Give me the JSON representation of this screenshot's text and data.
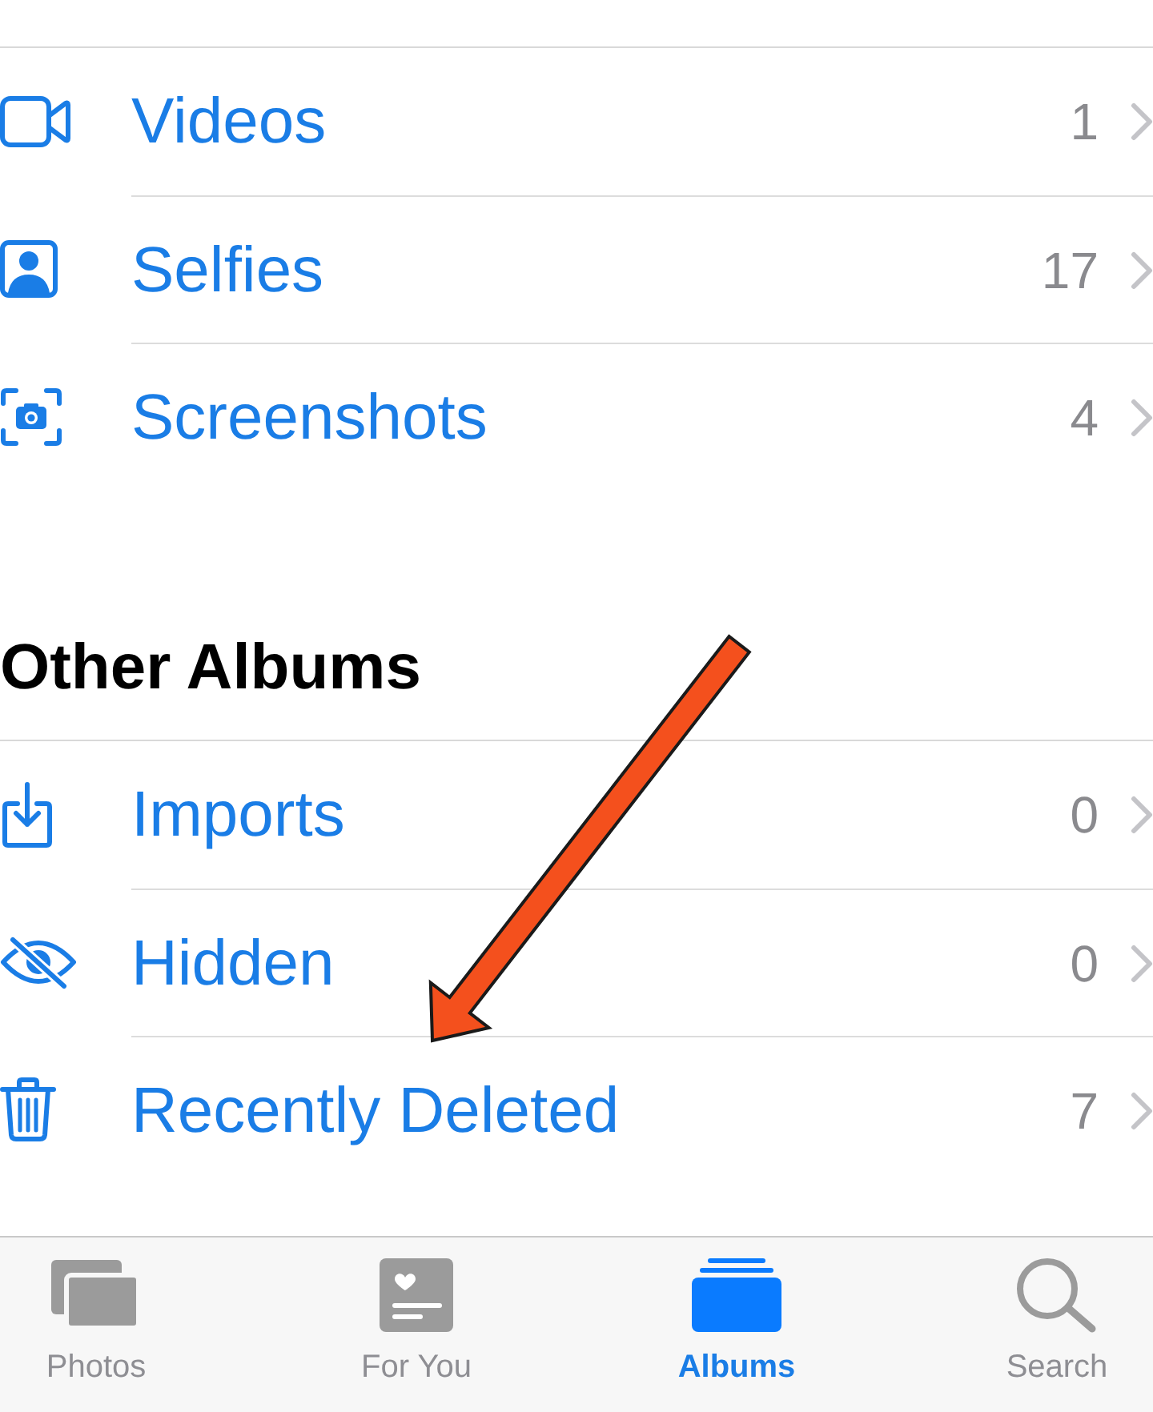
{
  "sections": [
    {
      "rows": [
        {
          "label": "Videos",
          "count": "1"
        },
        {
          "label": "Selfies",
          "count": "17"
        },
        {
          "label": "Screenshots",
          "count": "4"
        }
      ]
    },
    {
      "title": "Other Albums",
      "rows": [
        {
          "label": "Imports",
          "count": "0"
        },
        {
          "label": "Hidden",
          "count": "0"
        },
        {
          "label": "Recently Deleted",
          "count": "7"
        }
      ]
    }
  ],
  "tab_bar": {
    "tabs": [
      {
        "label": "Photos",
        "selected": false
      },
      {
        "label": "For You",
        "selected": false
      },
      {
        "label": "Albums",
        "selected": true
      },
      {
        "label": "Search",
        "selected": false
      }
    ]
  }
}
